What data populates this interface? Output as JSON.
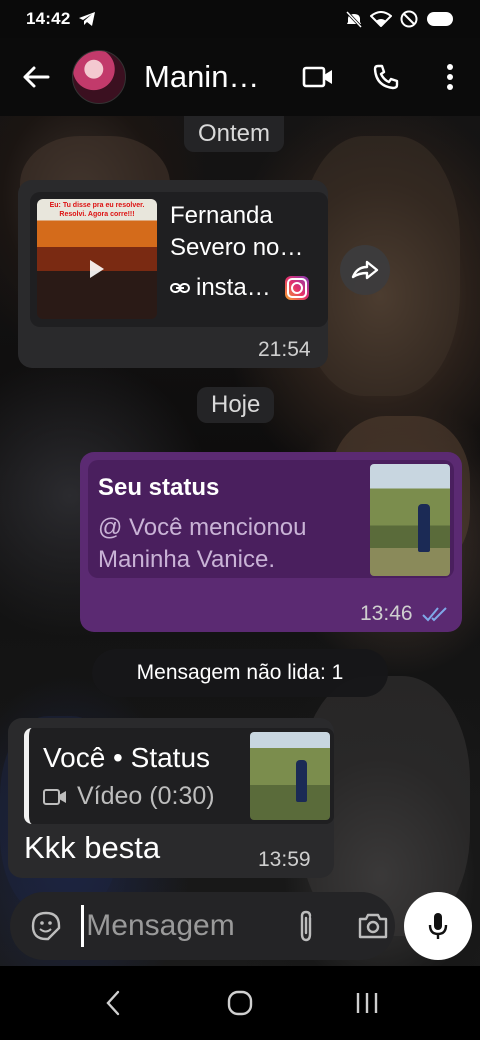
{
  "status_bar": {
    "time": "14:42"
  },
  "header": {
    "contact_name": "Manin…"
  },
  "chat": {
    "date_yesterday": "Ontem",
    "date_today": "Hoje",
    "link_message": {
      "title": "Fernanda Severo no…",
      "source": "insta…",
      "thumb_caption": "Eu: Tu disse pra eu resolver. Resolvi. Agora corre!!!",
      "time": "21:54"
    },
    "status_reply_out": {
      "title": "Seu status",
      "mention": "@ Você mencionou Maninha Vanice.",
      "time": "13:46"
    },
    "unread_label": "Mensagem não lida: 1",
    "incoming_reply": {
      "quoted_who": "Você • Status",
      "quoted_what": "Vídeo (0:30)",
      "text": "Kkk besta",
      "time": "13:59"
    }
  },
  "composer": {
    "placeholder": "Mensagem"
  },
  "colors": {
    "outgoing_bubble": "#5b2a72",
    "incoming_bubble": "#2a2a2c",
    "read_ticks": "#7fa8e8"
  },
  "icons": [
    "telegram-icon",
    "mute-icon",
    "wifi-icon",
    "dnd-icon",
    "battery-icon",
    "back-arrow-icon",
    "video-call-icon",
    "phone-icon",
    "more-vert-icon",
    "link-icon",
    "instagram-icon",
    "forward-icon",
    "double-check-icon",
    "video-icon",
    "sticker-icon",
    "attach-icon",
    "camera-icon",
    "mic-icon",
    "nav-back-icon",
    "nav-home-icon",
    "nav-recents-icon"
  ]
}
